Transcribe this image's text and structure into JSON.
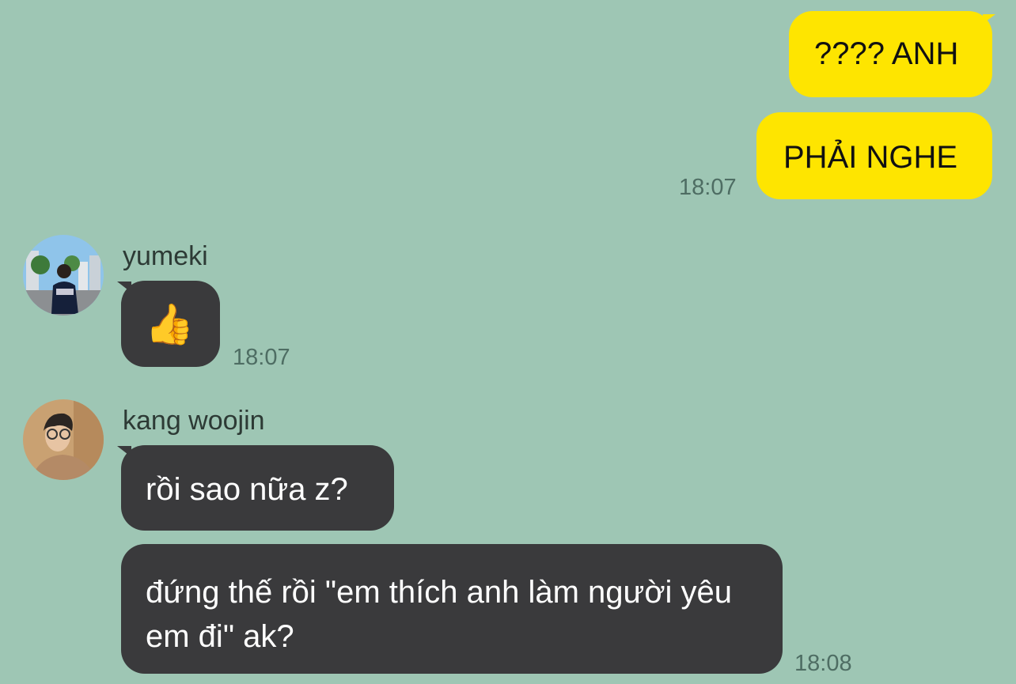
{
  "colors": {
    "background": "#9ec6b4",
    "outgoing_bubble": "#fee500",
    "incoming_bubble": "#3a3a3c",
    "timestamp": "#4e6d63"
  },
  "messages": {
    "outgoing_1": {
      "text": "???? ANH"
    },
    "outgoing_2": {
      "text": "PHẢI NGHE",
      "time": "18:07"
    },
    "yumeki": {
      "sender": "yumeki",
      "avatar_icon": "profile-photo-icon",
      "text": "👍",
      "time": "18:07"
    },
    "kang": {
      "sender": "kang woojin",
      "avatar_icon": "profile-photo-icon",
      "text_1": "rồi sao nữa z?",
      "text_2": "đứng thế rồi \"em thích anh làm người yêu em đi\" ak?",
      "time": "18:08"
    }
  }
}
